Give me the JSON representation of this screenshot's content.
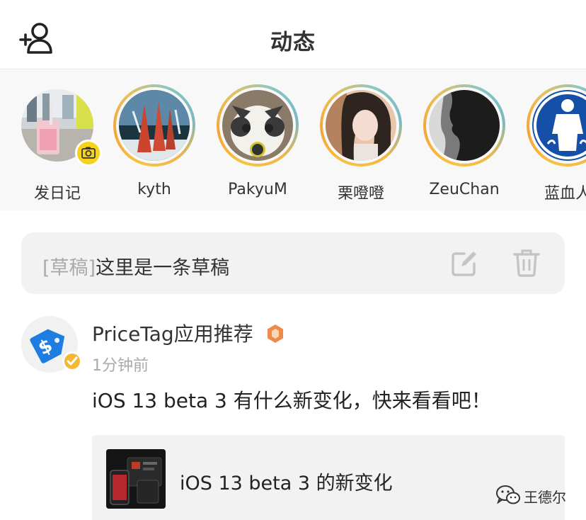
{
  "header": {
    "title": "动态",
    "add_friend_icon": "add-user-icon"
  },
  "stories": [
    {
      "label": "发日记",
      "avatar": "photo-drink",
      "badge_icon": "camera-icon",
      "ring": false
    },
    {
      "label": "kyth",
      "avatar": "photo-art",
      "ring": true
    },
    {
      "label": "PakyuM",
      "avatar": "photo-cat",
      "ring": true
    },
    {
      "label": "栗噔噔",
      "avatar": "photo-girl",
      "ring": true
    },
    {
      "label": "ZeuChan",
      "avatar": "photo-profile",
      "ring": true
    },
    {
      "label": "蓝血人",
      "avatar": "photo-blue-figure",
      "ring": true
    }
  ],
  "draft": {
    "tag": "[草稿]",
    "text": "这里是一条草稿",
    "edit_icon": "edit-icon",
    "delete_icon": "trash-icon"
  },
  "post": {
    "author": "PriceTag应用推荐",
    "time": "1分钟前",
    "text": "iOS 13 beta 3 有什么新变化，快来看看吧！",
    "link_card": {
      "title": "iOS 13 beta 3 的新变化"
    }
  },
  "watermark": {
    "text": "王德尔"
  },
  "colors": {
    "accent_yellow": "#f7d21b",
    "ring_gold": "#f4a53a",
    "ring_teal": "#79b9c0",
    "badge_orange": "#ee8a4a",
    "pricetag_blue": "#1d7de0"
  }
}
